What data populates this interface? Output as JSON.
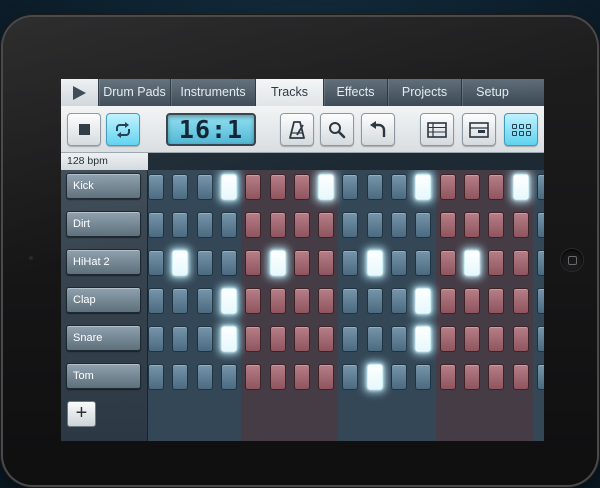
{
  "tabs": [
    {
      "label": "Drum Pads",
      "active": false
    },
    {
      "label": "Instruments",
      "active": false
    },
    {
      "label": "Tracks",
      "active": true
    },
    {
      "label": "Effects",
      "active": false
    },
    {
      "label": "Projects",
      "active": false
    },
    {
      "label": "Setup",
      "active": false
    }
  ],
  "toolbar": {
    "time_display": "16:1",
    "loop_active": true,
    "grid_view_active": true
  },
  "tempo": "128 bpm",
  "bar_marker": "3",
  "channels": [
    {
      "name": "Kick",
      "steps": [
        0,
        0,
        0,
        1,
        0,
        0,
        0,
        1,
        0,
        0,
        0,
        1,
        0,
        0,
        0,
        1,
        0
      ]
    },
    {
      "name": "Dirt",
      "steps": [
        0,
        0,
        0,
        0,
        0,
        0,
        0,
        0,
        0,
        0,
        0,
        0,
        0,
        0,
        0,
        0,
        0
      ]
    },
    {
      "name": "HiHat 2",
      "steps": [
        0,
        1,
        0,
        0,
        0,
        1,
        0,
        0,
        0,
        1,
        0,
        0,
        0,
        1,
        0,
        0,
        0
      ]
    },
    {
      "name": "Clap",
      "steps": [
        0,
        0,
        0,
        1,
        0,
        0,
        0,
        0,
        0,
        0,
        0,
        1,
        0,
        0,
        0,
        0,
        0
      ]
    },
    {
      "name": "Snare",
      "steps": [
        0,
        0,
        0,
        1,
        0,
        0,
        0,
        0,
        0,
        0,
        0,
        1,
        0,
        0,
        0,
        0,
        0
      ]
    },
    {
      "name": "Tom",
      "steps": [
        0,
        0,
        0,
        0,
        0,
        0,
        0,
        0,
        0,
        1,
        0,
        0,
        0,
        0,
        0,
        0,
        0
      ]
    }
  ],
  "step_group_colors": [
    "blue",
    "red",
    "blue",
    "red",
    "blue"
  ],
  "colors": {
    "accent": "#5fd3f0",
    "pad_blue": "#5d7c92",
    "pad_red": "#a26a72",
    "pad_lit": "#ffffff"
  },
  "icons": {
    "play": "play-icon",
    "stop": "stop-icon",
    "loop": "loop-icon",
    "metronome": "metronome-icon",
    "zoom": "magnifier-icon",
    "undo": "undo-icon",
    "list_view": "list-view-icon",
    "piano_roll_view": "piano-roll-icon",
    "grid_view": "grid-view-icon",
    "add": "plus-icon"
  },
  "add_label": "+"
}
